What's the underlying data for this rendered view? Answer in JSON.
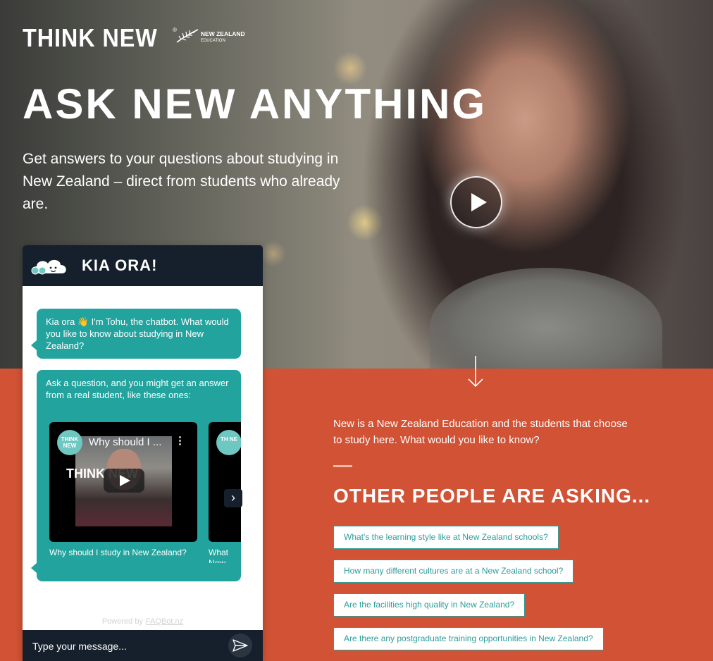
{
  "brand": {
    "logo_text": "THINK NEW",
    "logo_mark": "®",
    "partner_line1": "NEW ZEALAND",
    "partner_line2": "EDUCATION"
  },
  "hero": {
    "headline": "ASK NEW ANYTHING",
    "subtitle": "Get answers to your questions about studying in New Zealand – direct from students who already are."
  },
  "chat": {
    "header_title": "KIA ORA!",
    "greeting": "Kia ora 👋 I'm Tohu, the chatbot. What would you like to know about studying in New Zealand?",
    "prompt": "Ask a question, and you might get an answer from a real student, like these ones:",
    "videos": [
      {
        "overlay_title": "Why should I ...",
        "logo": "THINK NEW",
        "thumb_text": "THINK NEW",
        "caption": "Why should I study in New Zealand?"
      },
      {
        "overlay_title": "",
        "logo": "TH NE",
        "thumb_text": "",
        "caption": "What\nNew"
      }
    ],
    "powered_label": "Powered by",
    "powered_link": "FAQBot.nz",
    "input_placeholder": "Type your message..."
  },
  "info": {
    "text": "New is a New Zealand Education and the students that choose to study here. What would you like to know?",
    "section_title": "OTHER PEOPLE ARE ASKING..."
  },
  "questions": [
    "What's the learning style like at New Zealand schools?",
    "How many different cultures are at a New Zealand school?",
    "Are the facilities high quality in New Zealand?",
    "Are there any postgraduate training opportunities in New Zealand?"
  ],
  "colors": {
    "accent_orange": "#d15234",
    "teal": "#22a39e",
    "navy": "#15202c"
  },
  "icons": [
    "fern-icon",
    "play-icon",
    "arrow-down-icon",
    "cloud-mascot-icon",
    "chevron-right-icon",
    "send-icon",
    "more-vert-icon"
  ]
}
